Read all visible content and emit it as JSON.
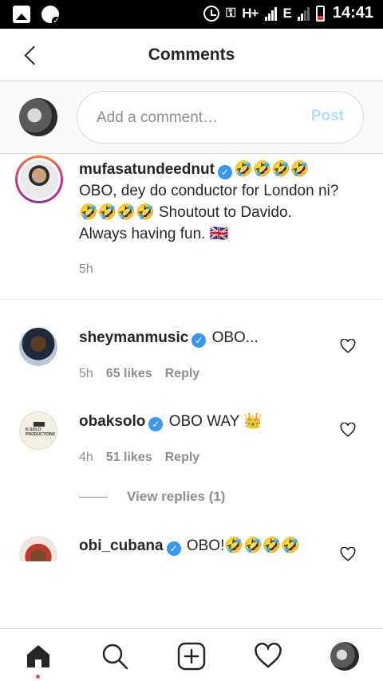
{
  "status_bar": {
    "network_1": "H+",
    "network_2": "E",
    "time": "14:41"
  },
  "header": {
    "title": "Comments",
    "back_icon": "chevron-left-icon"
  },
  "composer": {
    "placeholder": "Add a comment…",
    "post_label": "Post",
    "post_color": "#b2dffc"
  },
  "caption": {
    "username": "mufasatundeednut",
    "line1_suffix": "🤣🤣🤣🤣",
    "text": "OBO, dey do conductor for London ni? 🤣🤣🤣🤣 Shoutout to Davido. Always having fun. 🇬🇧",
    "time": "5h"
  },
  "comments": [
    {
      "username": "sheymanmusic",
      "text": "OBO...",
      "time": "5h",
      "likes": "65 likes",
      "reply": "Reply"
    },
    {
      "username": "obaksolo",
      "text": "OBO WAY 👑",
      "time": "4h",
      "likes": "51 likes",
      "reply": "Reply",
      "avatar_logo": "K-SOLO PRODUCTIONS",
      "view_replies": "View replies (1)"
    },
    {
      "username": "obi_cubana",
      "text": "OBO!🤣🤣🤣🤣"
    }
  ],
  "colors": {
    "verified": "#3897f0",
    "meta_gray": "#8e8e8e",
    "notification_dot": "#ed4956"
  },
  "bottom_nav": [
    "home-icon",
    "search-icon",
    "new-post-icon",
    "activity-heart-icon",
    "profile-avatar"
  ]
}
